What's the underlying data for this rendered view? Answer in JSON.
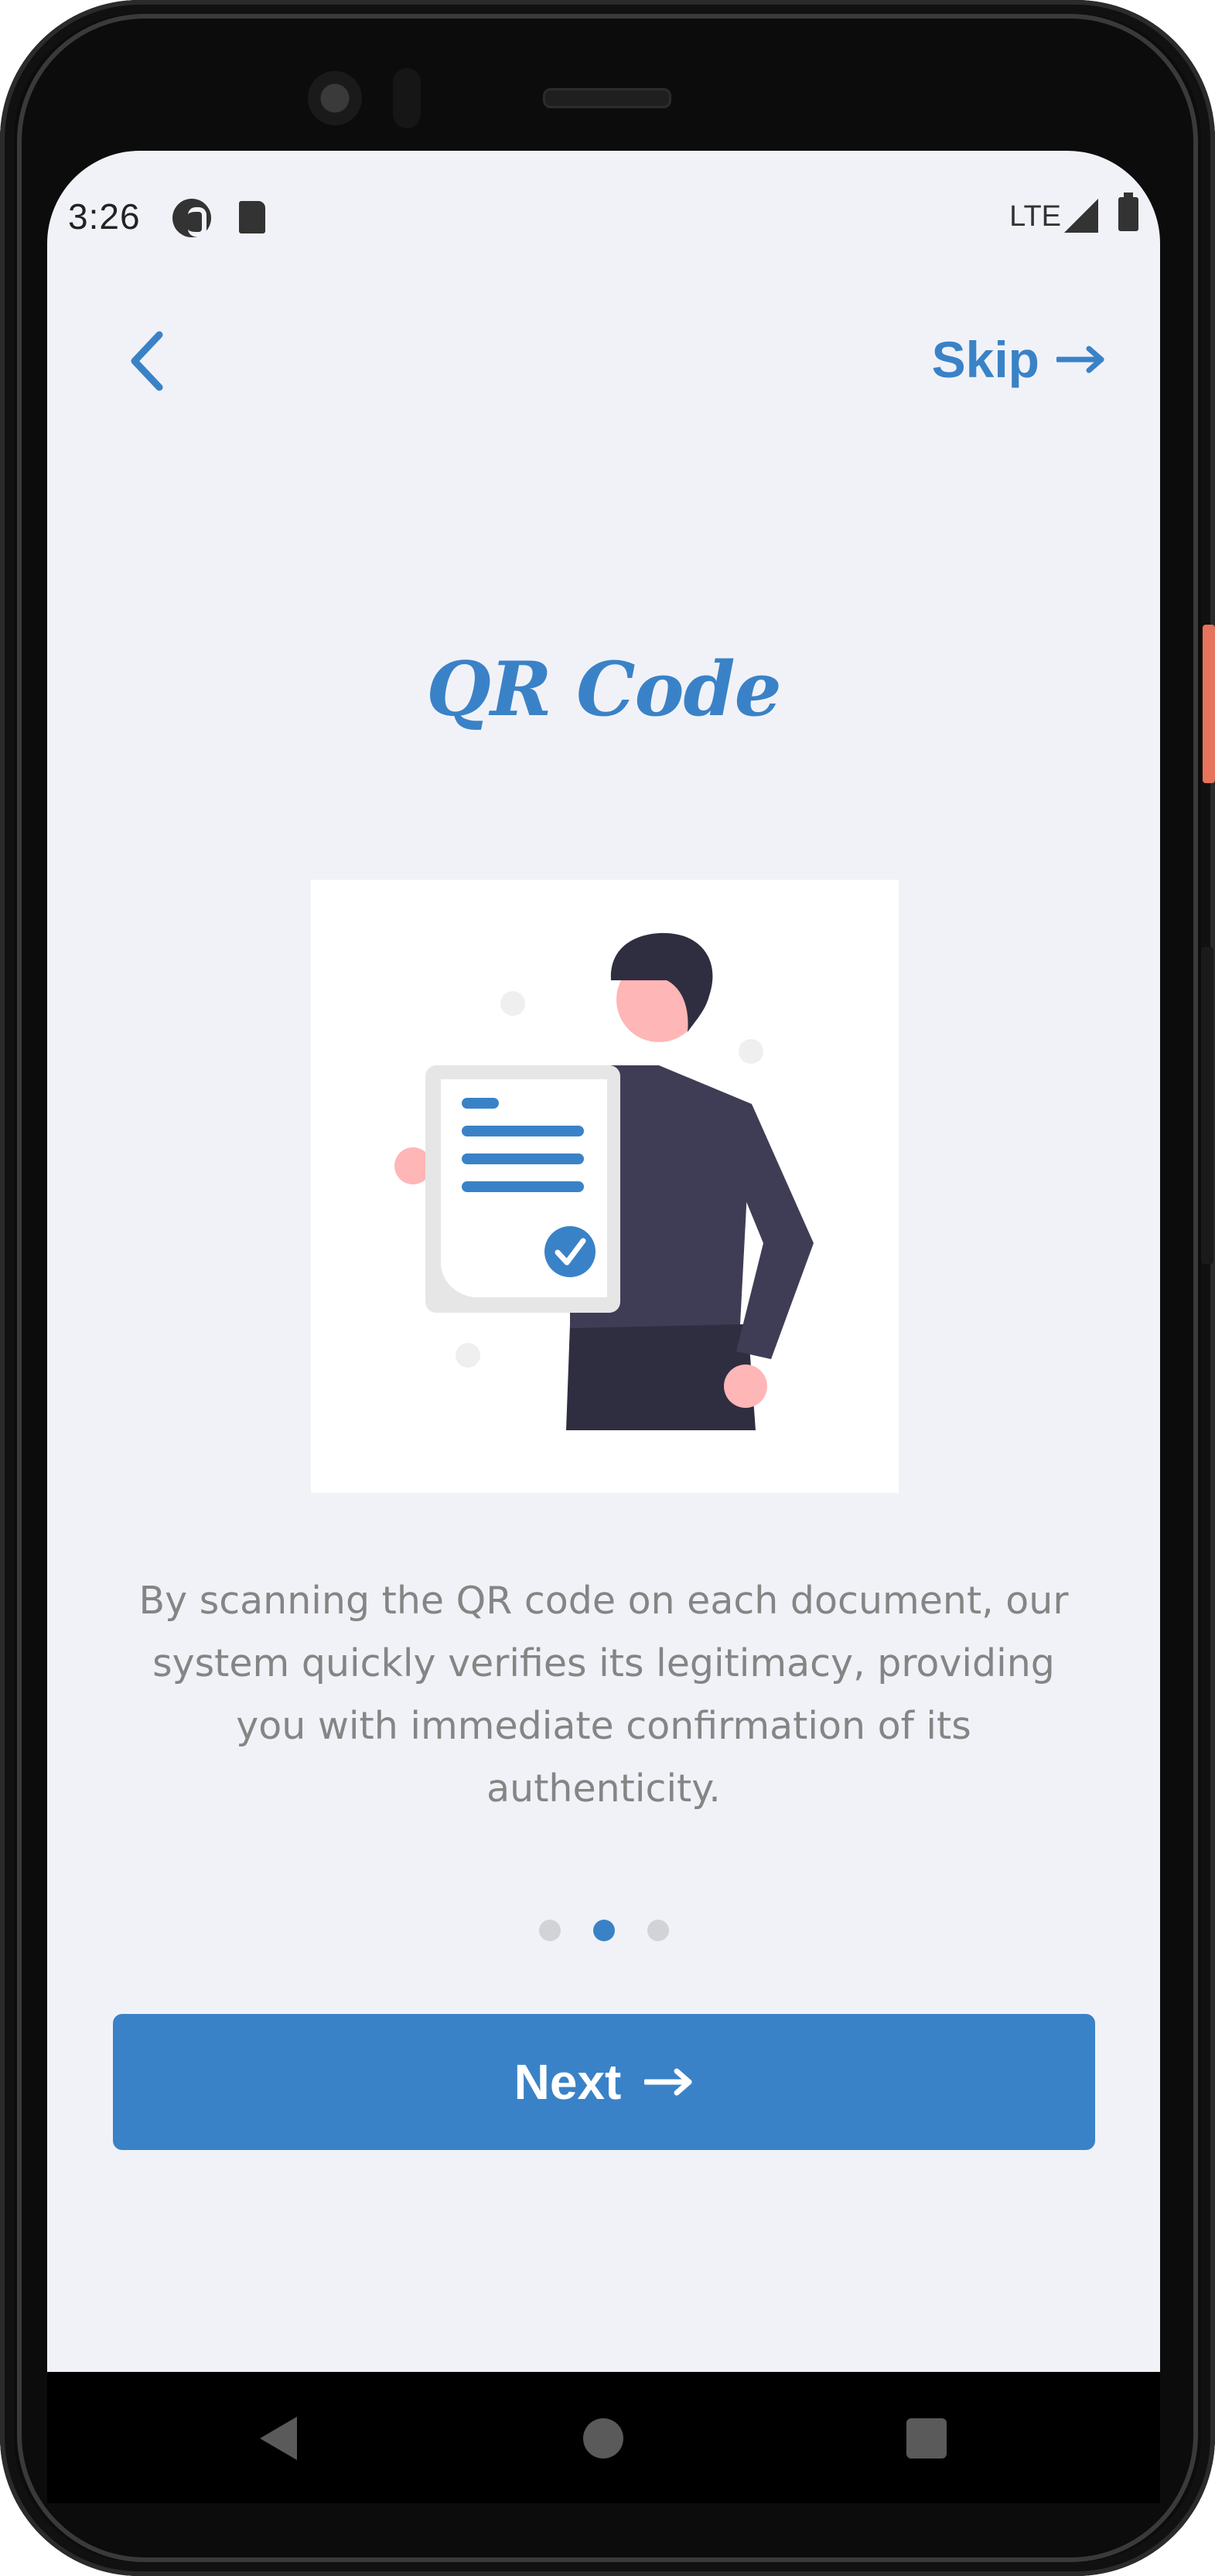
{
  "status_bar": {
    "time": "3:26",
    "network": "LTE",
    "icons": [
      "pocket-casts-icon",
      "sd-card-icon",
      "signal-icon",
      "battery-icon"
    ]
  },
  "header": {
    "back_icon": "chevron-left-icon",
    "skip_label": "Skip",
    "skip_icon": "arrow-right-icon"
  },
  "main": {
    "title": "QR Code",
    "illustration": "person-holding-verified-document-illustration",
    "description": "By scanning the QR code on each document, our system quickly verifies its legitimacy, providing you with immediate confirmation of its authenticity."
  },
  "pager": {
    "total": 3,
    "active_index": 1
  },
  "footer": {
    "next_label": "Next",
    "next_icon": "arrow-right-icon"
  },
  "nav_bar": {
    "items": [
      "back-triangle-icon",
      "home-circle-icon",
      "recents-square-icon"
    ]
  },
  "colors": {
    "accent": "#3a82c7",
    "background": "#f1f2f7",
    "body_text": "#858585",
    "dot_inactive": "#d2d3d6"
  }
}
